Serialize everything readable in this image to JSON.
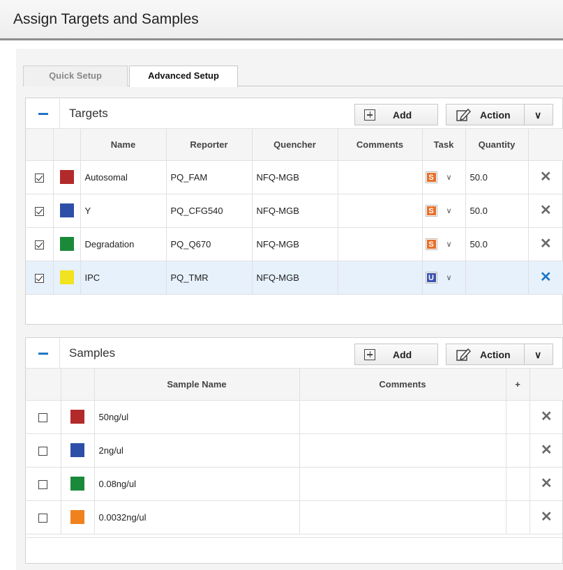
{
  "page_title": "Assign Targets and Samples",
  "tabs": [
    {
      "label": "Quick Setup",
      "active": false
    },
    {
      "label": "Advanced Setup",
      "active": true
    }
  ],
  "targets": {
    "title": "Targets",
    "add_label": "Add",
    "action_label": "Action",
    "icons": {
      "collapse": "minus-icon",
      "add": "plus-box-icon",
      "action": "edit-icon",
      "dropdown": "chevron-down-icon",
      "delete": "close-icon"
    },
    "columns": [
      "Name",
      "Reporter",
      "Quencher",
      "Comments",
      "Task",
      "Quantity"
    ],
    "rows": [
      {
        "checked": true,
        "color": "#b22a2a",
        "name": "Autosomal",
        "reporter": "PQ_FAM",
        "quencher": "NFQ-MGB",
        "comments": "",
        "task": "S",
        "task_color": "#e8702a",
        "quantity": "50.0",
        "selected": false
      },
      {
        "checked": true,
        "color": "#2e4fa8",
        "name": "Y",
        "reporter": "PQ_CFG540",
        "quencher": "NFQ-MGB",
        "comments": "",
        "task": "S",
        "task_color": "#e8702a",
        "quantity": "50.0",
        "selected": false
      },
      {
        "checked": true,
        "color": "#1a8a3a",
        "name": "Degradation",
        "reporter": "PQ_Q670",
        "quencher": "NFQ-MGB",
        "comments": "",
        "task": "S",
        "task_color": "#e8702a",
        "quantity": "50.0",
        "selected": false
      },
      {
        "checked": true,
        "color": "#f2e320",
        "name": "IPC",
        "reporter": "PQ_TMR",
        "quencher": "NFQ-MGB",
        "comments": "",
        "task": "U",
        "task_color": "#3b55b0",
        "quantity": "",
        "selected": true
      }
    ]
  },
  "samples": {
    "title": "Samples",
    "add_label": "Add",
    "action_label": "Action",
    "columns": [
      "Sample Name",
      "Comments",
      "+"
    ],
    "rows": [
      {
        "checked": false,
        "color": "#b22a2a",
        "name": "50ng/ul",
        "comments": ""
      },
      {
        "checked": false,
        "color": "#2e4fa8",
        "name": "2ng/ul",
        "comments": ""
      },
      {
        "checked": false,
        "color": "#1a8a3a",
        "name": "0.08ng/ul",
        "comments": ""
      },
      {
        "checked": false,
        "color": "#f0821e",
        "name": "0.0032ng/ul",
        "comments": ""
      }
    ]
  }
}
